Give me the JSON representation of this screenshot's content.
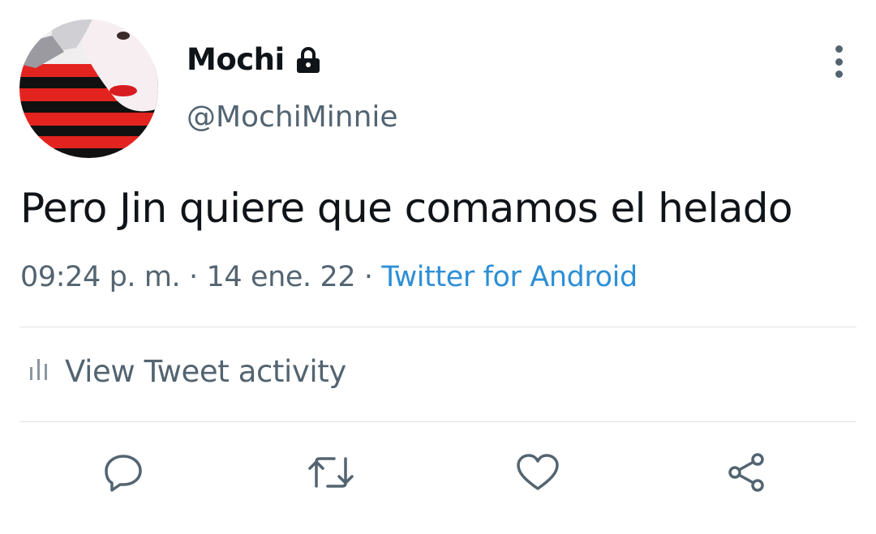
{
  "tweet": {
    "display_name": "Mochi",
    "handle": "@MochiMinnie",
    "text": "Pero Jin quiere que comamos el helado",
    "time": "09:24 p. m.",
    "separator": "·",
    "date": "14 ene. 22",
    "source": "Twitter for Android"
  },
  "activity": {
    "label": "View Tweet activity"
  },
  "icons": {
    "lock": "lock-icon",
    "more": "more-vertical-icon",
    "activity": "bar-chart-icon",
    "reply": "reply-icon",
    "retweet": "retweet-icon",
    "like": "heart-icon",
    "share": "share-icon"
  },
  "colors": {
    "text": "#0f1419",
    "secondary": "#536471",
    "link": "#2d8fd6",
    "divider": "#dfe3e6"
  }
}
